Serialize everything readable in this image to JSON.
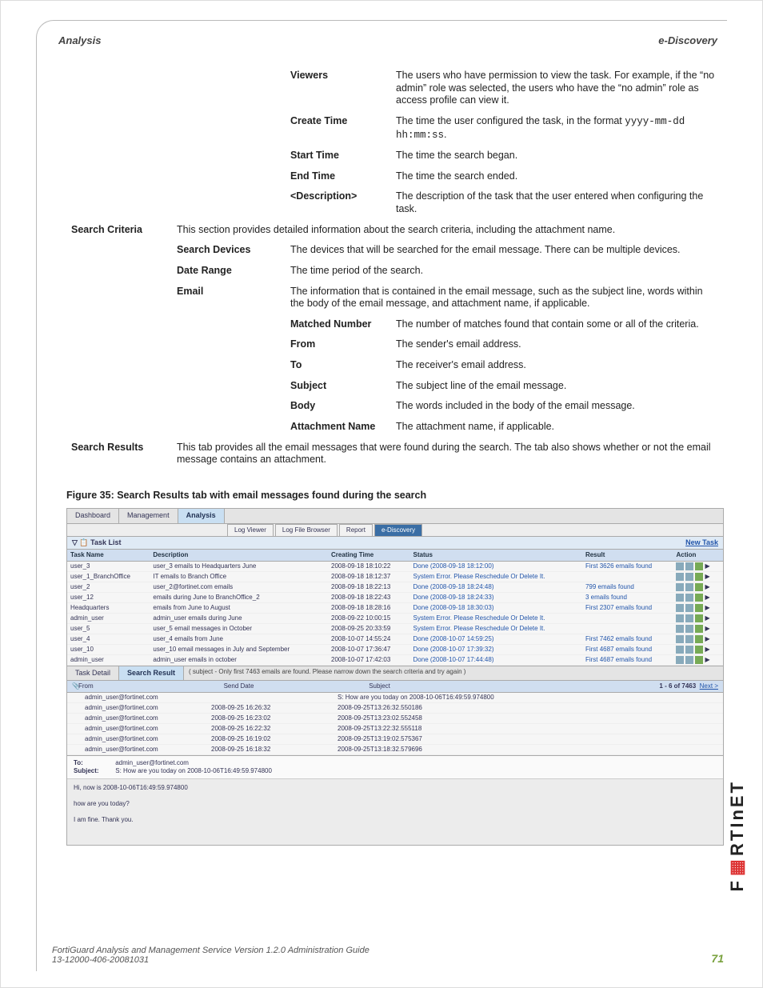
{
  "header": {
    "left": "Analysis",
    "right": "e-Discovery"
  },
  "defs": {
    "viewers": {
      "term": "Viewers",
      "desc": "The users who have permission to view the task. For example, if the “no admin” role was selected, the users who have the “no admin” role as access profile can view it."
    },
    "createTime": {
      "term": "Create Time",
      "desc_pre": "The time the user configured the task, in the format ",
      "desc_code": "yyyy-mm-dd hh:mm:ss",
      "desc_post": "."
    },
    "startTime": {
      "term": "Start Time",
      "desc": "The time the search began."
    },
    "endTime": {
      "term": "End Time",
      "desc": "The time the search ended."
    },
    "description": {
      "term": "<Description>",
      "desc": "The description of the task that the user entered when configuring the task."
    },
    "searchCriteria": {
      "term": "Search Criteria",
      "desc": "This section provides detailed information about the search criteria, including the attachment name."
    },
    "searchDevices": {
      "term": "Search Devices",
      "desc": "The devices that will be searched for the email message. There can be multiple devices."
    },
    "dateRange": {
      "term": "Date Range",
      "desc": "The time period of the search."
    },
    "email": {
      "term": "Email",
      "desc": "The information that is contained in the email message, such as the subject line, words within the body of the email message, and attachment name, if applicable."
    },
    "matchedNumber": {
      "term": "Matched Number",
      "desc": "The number of matches found that contain some or all of the criteria."
    },
    "from": {
      "term": "From",
      "desc": "The sender's email address."
    },
    "to": {
      "term": "To",
      "desc": "The receiver's email address."
    },
    "subject": {
      "term": "Subject",
      "desc": "The subject line of the email message."
    },
    "body": {
      "term": "Body",
      "desc": "The words included in the body of the email message."
    },
    "attachmentName": {
      "term": "Attachment Name",
      "desc": "The attachment name, if applicable."
    },
    "searchResults": {
      "term": "Search Results",
      "desc": "This tab provides all the email messages that were found during the search. The tab also shows whether or not the email message contains an attachment."
    }
  },
  "figcap": "Figure 35: Search Results tab with email messages found during the search",
  "screenshot": {
    "mainTabs": [
      "Dashboard",
      "Management",
      "Analysis"
    ],
    "mainTabActive": "Analysis",
    "subTabs": [
      "Log Viewer",
      "Log File Browser",
      "Report",
      "e-Discovery"
    ],
    "subTabActive": "e-Discovery",
    "taskListLabel": "Task List",
    "newTask": "New Task",
    "taskHeaders": [
      "Task Name",
      "Description",
      "Creating Time",
      "Status",
      "Result",
      "Action"
    ],
    "tasks": [
      {
        "name": "user_3",
        "desc": "user_3 emails to Headquarters June",
        "time": "2008-09-18 18:10:22",
        "status": "Done (2008-09-18 18:12:00)",
        "result": "First 3626 emails found"
      },
      {
        "name": "user_1_BranchOffice",
        "desc": "IT emails to Branch Office",
        "time": "2008-09-18 18:12:37",
        "status": "System Error. Please Reschedule Or Delete It.",
        "result": ""
      },
      {
        "name": "user_2",
        "desc": "user_2@fortinet.com emails",
        "time": "2008-09-18 18:22:13",
        "status": "Done (2008-09-18 18:24:48)",
        "result": "799 emails found"
      },
      {
        "name": "user_12",
        "desc": "emails during June to BranchOffice_2",
        "time": "2008-09-18 18:22:43",
        "status": "Done (2008-09-18 18:24:33)",
        "result": "3 emails found"
      },
      {
        "name": "Headquarters",
        "desc": "emails from June to August",
        "time": "2008-09-18 18:28:16",
        "status": "Done (2008-09-18 18:30:03)",
        "result": "First 2307 emails found"
      },
      {
        "name": "admin_user",
        "desc": "admin_user emails during June",
        "time": "2008-09-22 10:00:15",
        "status": "System Error. Please Reschedule Or Delete It.",
        "result": ""
      },
      {
        "name": "user_5",
        "desc": "user_5 email messages in October",
        "time": "2008-09-25 20:33:59",
        "status": "System Error. Please Reschedule Or Delete It.",
        "result": ""
      },
      {
        "name": "user_4",
        "desc": "user_4 emails from June",
        "time": "2008-10-07 14:55:24",
        "status": "Done (2008-10-07 14:59:25)",
        "result": "First 7462 emails found"
      },
      {
        "name": "user_10",
        "desc": "user_10 email messages in July and September",
        "time": "2008-10-07 17:36:47",
        "status": "Done (2008-10-07 17:39:32)",
        "result": "First 4687 emails found"
      },
      {
        "name": "admin_user",
        "desc": "admin_user emails in october",
        "time": "2008-10-07 17:42:03",
        "status": "Done (2008-10-07 17:44:48)",
        "result": "First 4687 emails found"
      }
    ],
    "secondaryTabs": [
      "Task Detail",
      "Search Result"
    ],
    "secondaryActive": "Search Result",
    "note": "( subject - Only first 7463 emails are found. Please narrow down the search criteria and try again )",
    "resultsHeaders": {
      "from": "From",
      "sendDate": "Send Date",
      "subject": "Subject"
    },
    "resultsCount": "1 - 6 of 7463",
    "resultsNext": "Next >",
    "results": [
      {
        "from": "admin_user@fortinet.com",
        "date": "",
        "subject": "S: How are you today on 2008-10-06T16:49:59.974800"
      },
      {
        "from": "admin_user@fortinet.com",
        "date": "2008-09-25 16:26:32",
        "subject": "2008-09-25T13:26:32.550186"
      },
      {
        "from": "admin_user@fortinet.com",
        "date": "2008-09-25 16:23:02",
        "subject": "2008-09-25T13:23:02.552458"
      },
      {
        "from": "admin_user@fortinet.com",
        "date": "2008-09-25 16:22:32",
        "subject": "2008-09-25T13:22:32.555118"
      },
      {
        "from": "admin_user@fortinet.com",
        "date": "2008-09-25 16:19:02",
        "subject": "2008-09-25T13:19:02.575367"
      },
      {
        "from": "admin_user@fortinet.com",
        "date": "2008-09-25 16:18:32",
        "subject": "2008-09-25T13:18:32.579696"
      }
    ],
    "preview": {
      "toLabel": "To:",
      "toVal": "admin_user@fortinet.com",
      "subjLabel": "Subject:",
      "subjVal": "S: How are you today on 2008-10-06T16:49:59.974800",
      "body1": "Hi, now is 2008-10-06T16:49:59.974800",
      "body2": "how are you today?",
      "body3": "I am fine. Thank you."
    }
  },
  "footer": {
    "guide": "FortiGuard Analysis and Management Service Version 1.2.0 Administration Guide",
    "docnum": "13-12000-406-20081031",
    "page": "71"
  },
  "brand": {
    "name": "F",
    "rest": "RTInET"
  }
}
